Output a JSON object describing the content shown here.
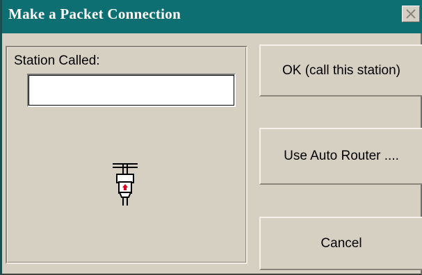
{
  "dialog": {
    "title": "Make a Packet Connection"
  },
  "form": {
    "station_label": "Station Called:",
    "station_value": ""
  },
  "buttons": {
    "ok_label": "OK (call this station)",
    "router_label": "Use Auto Router ....",
    "cancel_label": "Cancel"
  },
  "icons": {
    "close": "close-icon",
    "packet": "packet-connector-icon"
  },
  "colors": {
    "titlebar": "#0d6f72",
    "face": "#d6d0c3",
    "accent_red": "#e0001a"
  }
}
